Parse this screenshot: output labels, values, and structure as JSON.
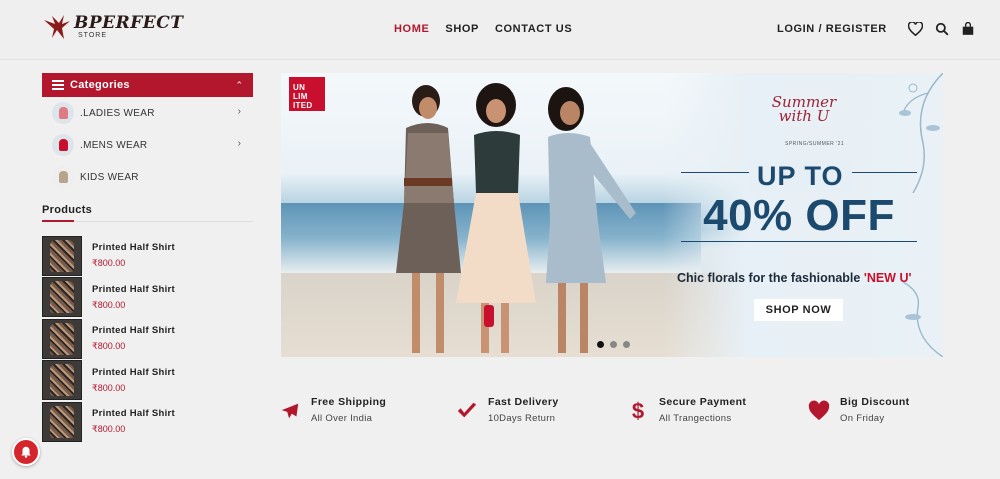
{
  "brand": {
    "name": "BPERFECT",
    "sub": "STORE"
  },
  "nav": [
    {
      "label": "HOME",
      "active": true
    },
    {
      "label": "SHOP",
      "active": false
    },
    {
      "label": "CONTACT US",
      "active": false
    }
  ],
  "header": {
    "login_label": "LOGIN / REGISTER",
    "icons": [
      "heart-icon",
      "search-icon",
      "cart-icon"
    ]
  },
  "categories": {
    "title": "Categories",
    "items": [
      {
        "label": ".LADIES WEAR",
        "has_arrow": true,
        "thumb_color": "#e07a86"
      },
      {
        "label": ".MENS WEAR",
        "has_arrow": true,
        "thumb_color": "#c8102e"
      },
      {
        "label": "KIDS WEAR",
        "has_arrow": false,
        "thumb_color": "#b8a48a"
      }
    ]
  },
  "products": {
    "title": "Products",
    "items": [
      {
        "name": "Printed Half Shirt",
        "price": "₹800.00"
      },
      {
        "name": "Printed Half Shirt",
        "price": "₹800.00"
      },
      {
        "name": "Printed Half Shirt",
        "price": "₹800.00"
      },
      {
        "name": "Printed Half Shirt",
        "price": "₹800.00"
      },
      {
        "name": "Printed Half Shirt",
        "price": "₹800.00"
      }
    ]
  },
  "banner": {
    "badge": "UN LIM ITED",
    "script_title": "Summer with U",
    "season": "SPRING/SUMMER '21",
    "headline_top": "UP TO",
    "headline_main": "40% OFF",
    "tagline": "Chic florals for the fashionable ",
    "tagline_highlight": "'NEW U'",
    "cta": "SHOP NOW",
    "slides": 3,
    "active_slide": 0
  },
  "features": [
    {
      "icon": "airplane-icon",
      "title": "Free Shipping",
      "sub": "All Over India"
    },
    {
      "icon": "checkmark-icon",
      "title": "Fast Delivery",
      "sub": "10Days Return"
    },
    {
      "icon": "dollar-icon",
      "title": "Secure Payment",
      "sub": "All Trangections"
    },
    {
      "icon": "heart-icon",
      "title": "Big Discount",
      "sub": "On Friday"
    }
  ],
  "colors": {
    "accent": "#b3172e",
    "banner_text": "#1c4a6e"
  }
}
